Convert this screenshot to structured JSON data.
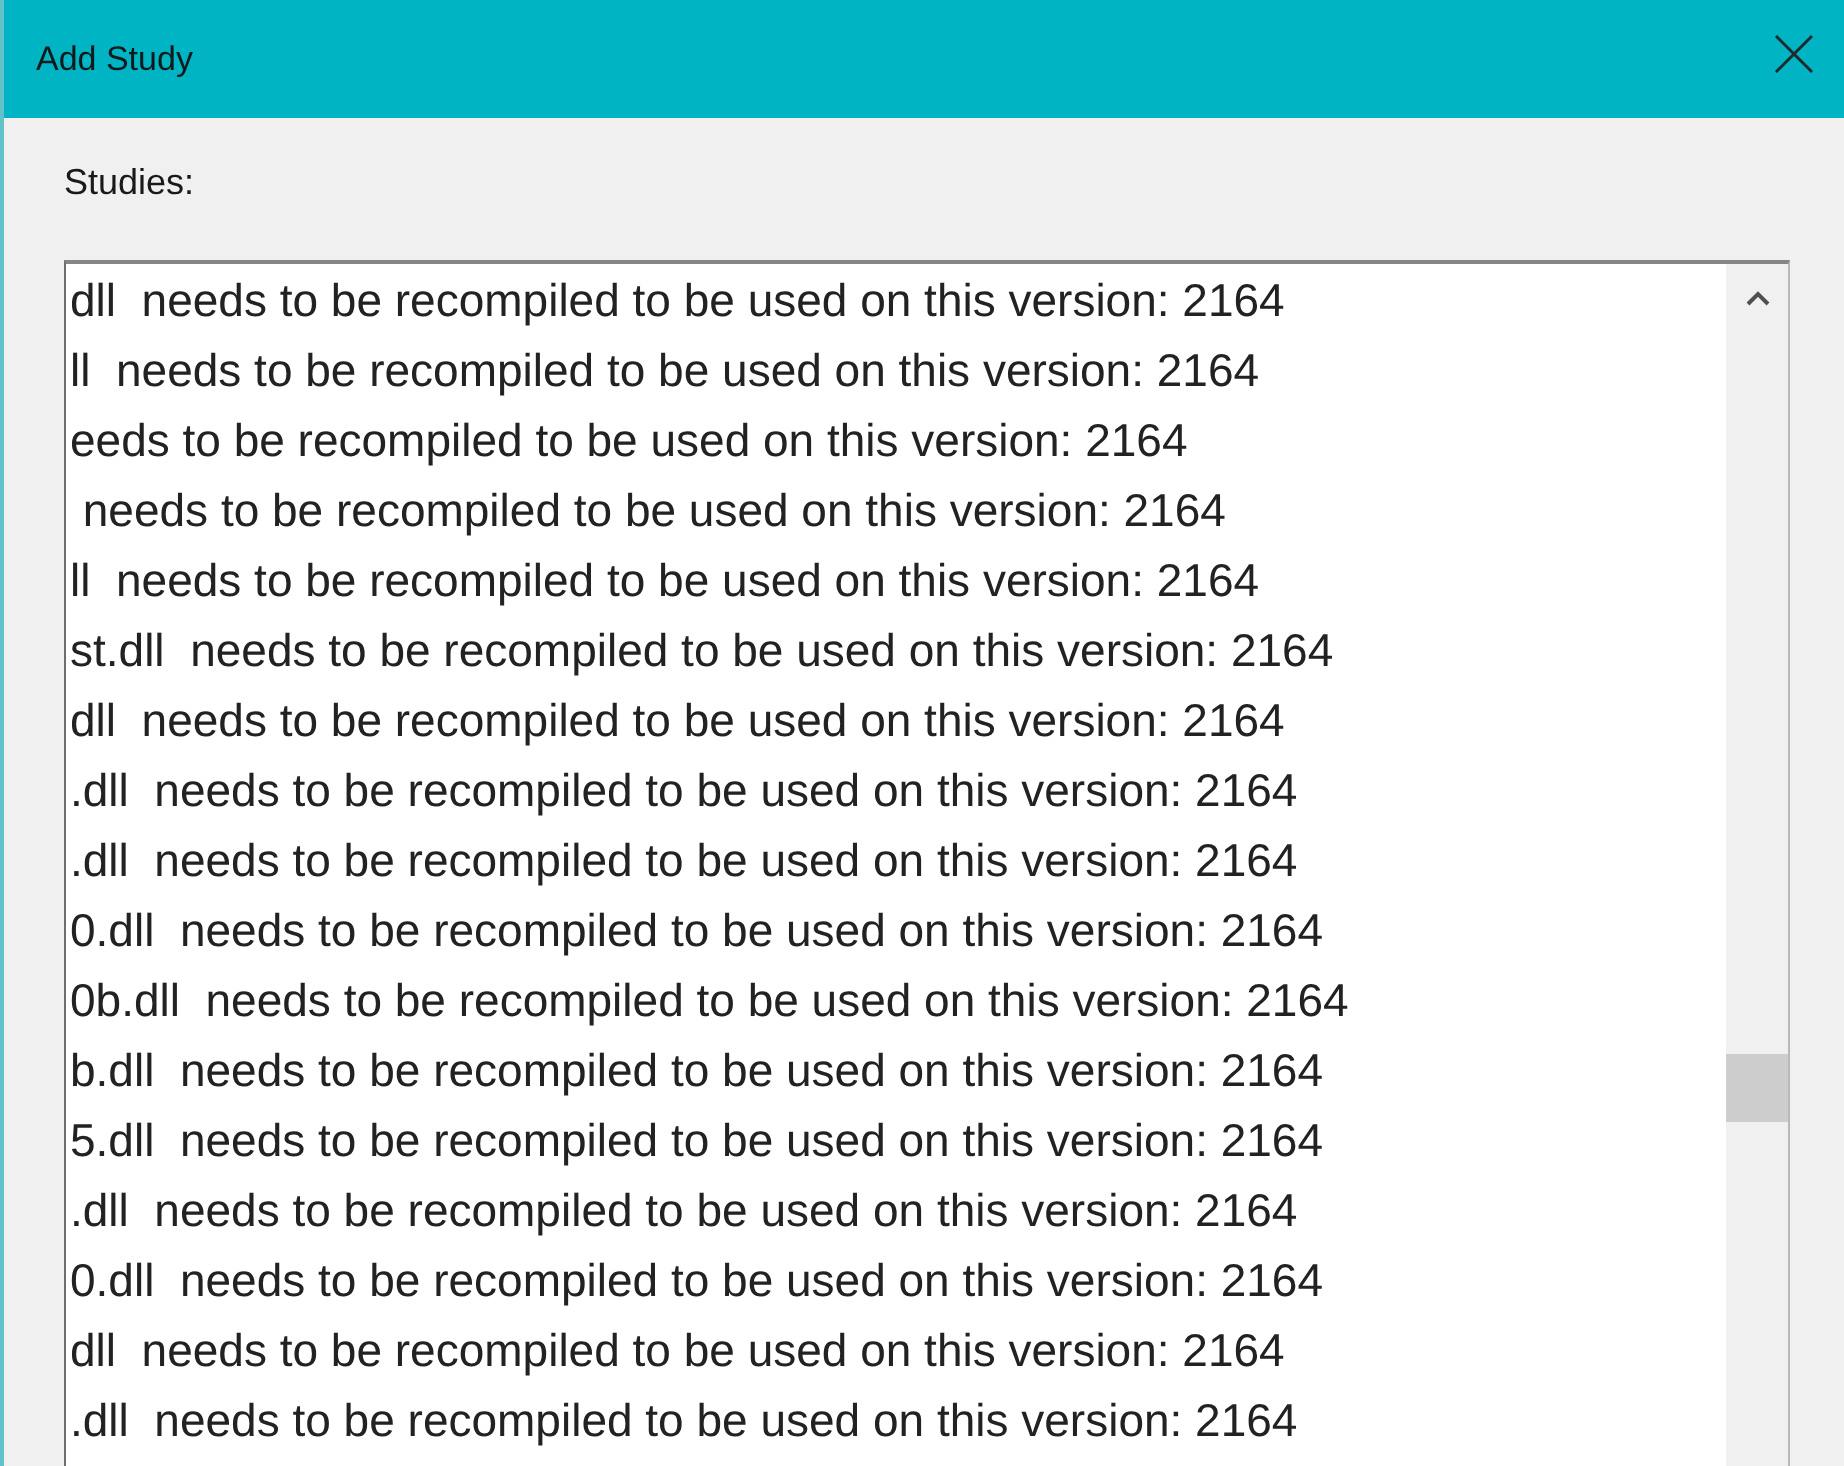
{
  "window": {
    "title": "Add Study"
  },
  "studies": {
    "label": "Studies:",
    "items": [
      "dll  needs to be recompiled to be used on this version: 2164",
      "ll  needs to be recompiled to be used on this version: 2164",
      "eeds to be recompiled to be used on this version: 2164",
      " needs to be recompiled to be used on this version: 2164",
      "ll  needs to be recompiled to be used on this version: 2164",
      "st.dll  needs to be recompiled to be used on this version: 2164",
      "dll  needs to be recompiled to be used on this version: 2164",
      ".dll  needs to be recompiled to be used on this version: 2164",
      ".dll  needs to be recompiled to be used on this version: 2164",
      "0.dll  needs to be recompiled to be used on this version: 2164",
      "0b.dll  needs to be recompiled to be used on this version: 2164",
      "b.dll  needs to be recompiled to be used on this version: 2164",
      "5.dll  needs to be recompiled to be used on this version: 2164",
      ".dll  needs to be recompiled to be used on this version: 2164",
      "0.dll  needs to be recompiled to be used on this version: 2164",
      "dll  needs to be recompiled to be used on this version: 2164",
      ".dll  needs to be recompiled to be used on this version: 2164"
    ]
  }
}
